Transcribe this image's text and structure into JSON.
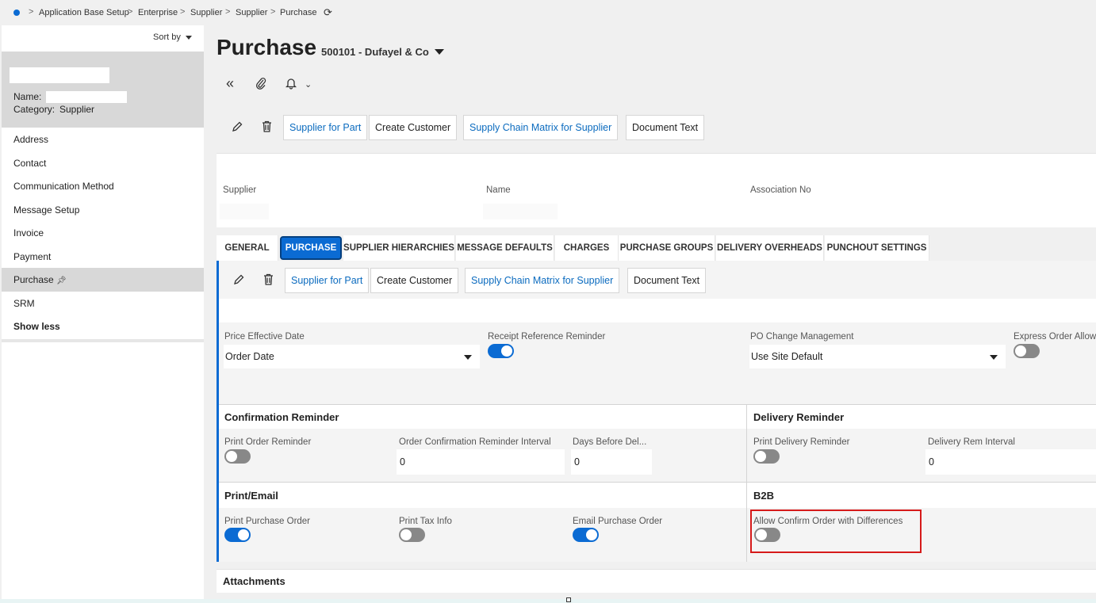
{
  "breadcrumb": {
    "items": [
      "Application Base Setup",
      "Enterprise",
      "Supplier",
      "Supplier",
      "Purchase"
    ],
    "separator": ">",
    "refresh_icon": "refresh-icon"
  },
  "sidebar": {
    "sort_label": "Sort by",
    "record": {
      "name_label": "Name:",
      "category_label": "Category:",
      "category_value": "Supplier"
    },
    "items": [
      {
        "label": "Address"
      },
      {
        "label": "Contact"
      },
      {
        "label": "Communication Method"
      },
      {
        "label": "Message Setup"
      },
      {
        "label": "Invoice"
      },
      {
        "label": "Payment"
      },
      {
        "label": "Purchase",
        "pin_icon": "pin-icon",
        "active": true
      },
      {
        "label": "SRM"
      }
    ],
    "show_less": "Show less"
  },
  "page": {
    "title": "Purchase",
    "subtitle": "500101 - Dufayel & Co"
  },
  "toolbar": {
    "icons": [
      "collapse-icon",
      "attachment-icon",
      "bell-icon",
      "chevron-down-icon"
    ]
  },
  "commands": {
    "edit_icon": "pencil-icon",
    "delete_icon": "trash-icon",
    "supplier_for_part": "Supplier for Part",
    "create_customer": "Create Customer",
    "supply_chain_matrix": "Supply Chain Matrix for Supplier",
    "document_text": "Document Text"
  },
  "header_fields": {
    "supplier_label": "Supplier",
    "name_label": "Name",
    "association_label": "Association No"
  },
  "tabs": [
    {
      "label": "GENERAL"
    },
    {
      "label": "PURCHASE",
      "active": true
    },
    {
      "label": "SUPPLIER HIERARCHIES"
    },
    {
      "label": "MESSAGE DEFAULTS"
    },
    {
      "label": "CHARGES"
    },
    {
      "label": "PURCHASE GROUPS"
    },
    {
      "label": "DELIVERY OVERHEADS"
    },
    {
      "label": "PUNCHOUT SETTINGS"
    }
  ],
  "purchase": {
    "price_effective_date": {
      "label": "Price Effective Date",
      "value": "Order Date"
    },
    "receipt_reference_reminder": {
      "label": "Receipt Reference Reminder",
      "on": true
    },
    "po_change_management": {
      "label": "PO Change Management",
      "value": "Use Site Default"
    },
    "express_order": {
      "label": "Express Order Allow",
      "on": false
    }
  },
  "confirmation_reminder": {
    "title": "Confirmation Reminder",
    "print_order_reminder": {
      "label": "Print Order Reminder",
      "on": false
    },
    "interval": {
      "label": "Order Confirmation Reminder Interval",
      "value": "0"
    },
    "days_before": {
      "label": "Days Before Del...",
      "value": "0"
    }
  },
  "delivery_reminder": {
    "title": "Delivery Reminder",
    "print_delivery_reminder": {
      "label": "Print Delivery Reminder",
      "on": false
    },
    "interval": {
      "label": "Delivery Rem Interval",
      "value": "0"
    }
  },
  "print_email": {
    "title": "Print/Email",
    "print_purchase_order": {
      "label": "Print Purchase Order",
      "on": true
    },
    "print_tax_info": {
      "label": "Print Tax Info",
      "on": false
    },
    "email_purchase_order": {
      "label": "Email Purchase Order",
      "on": true
    }
  },
  "b2b": {
    "title": "B2B",
    "allow_confirm": {
      "label": "Allow Confirm Order with Differences",
      "on": false
    }
  },
  "attachments": {
    "title": "Attachments"
  },
  "colors": {
    "accent": "#0b6bd3",
    "highlight": "#d61a1a",
    "link": "#0b6bbf"
  }
}
